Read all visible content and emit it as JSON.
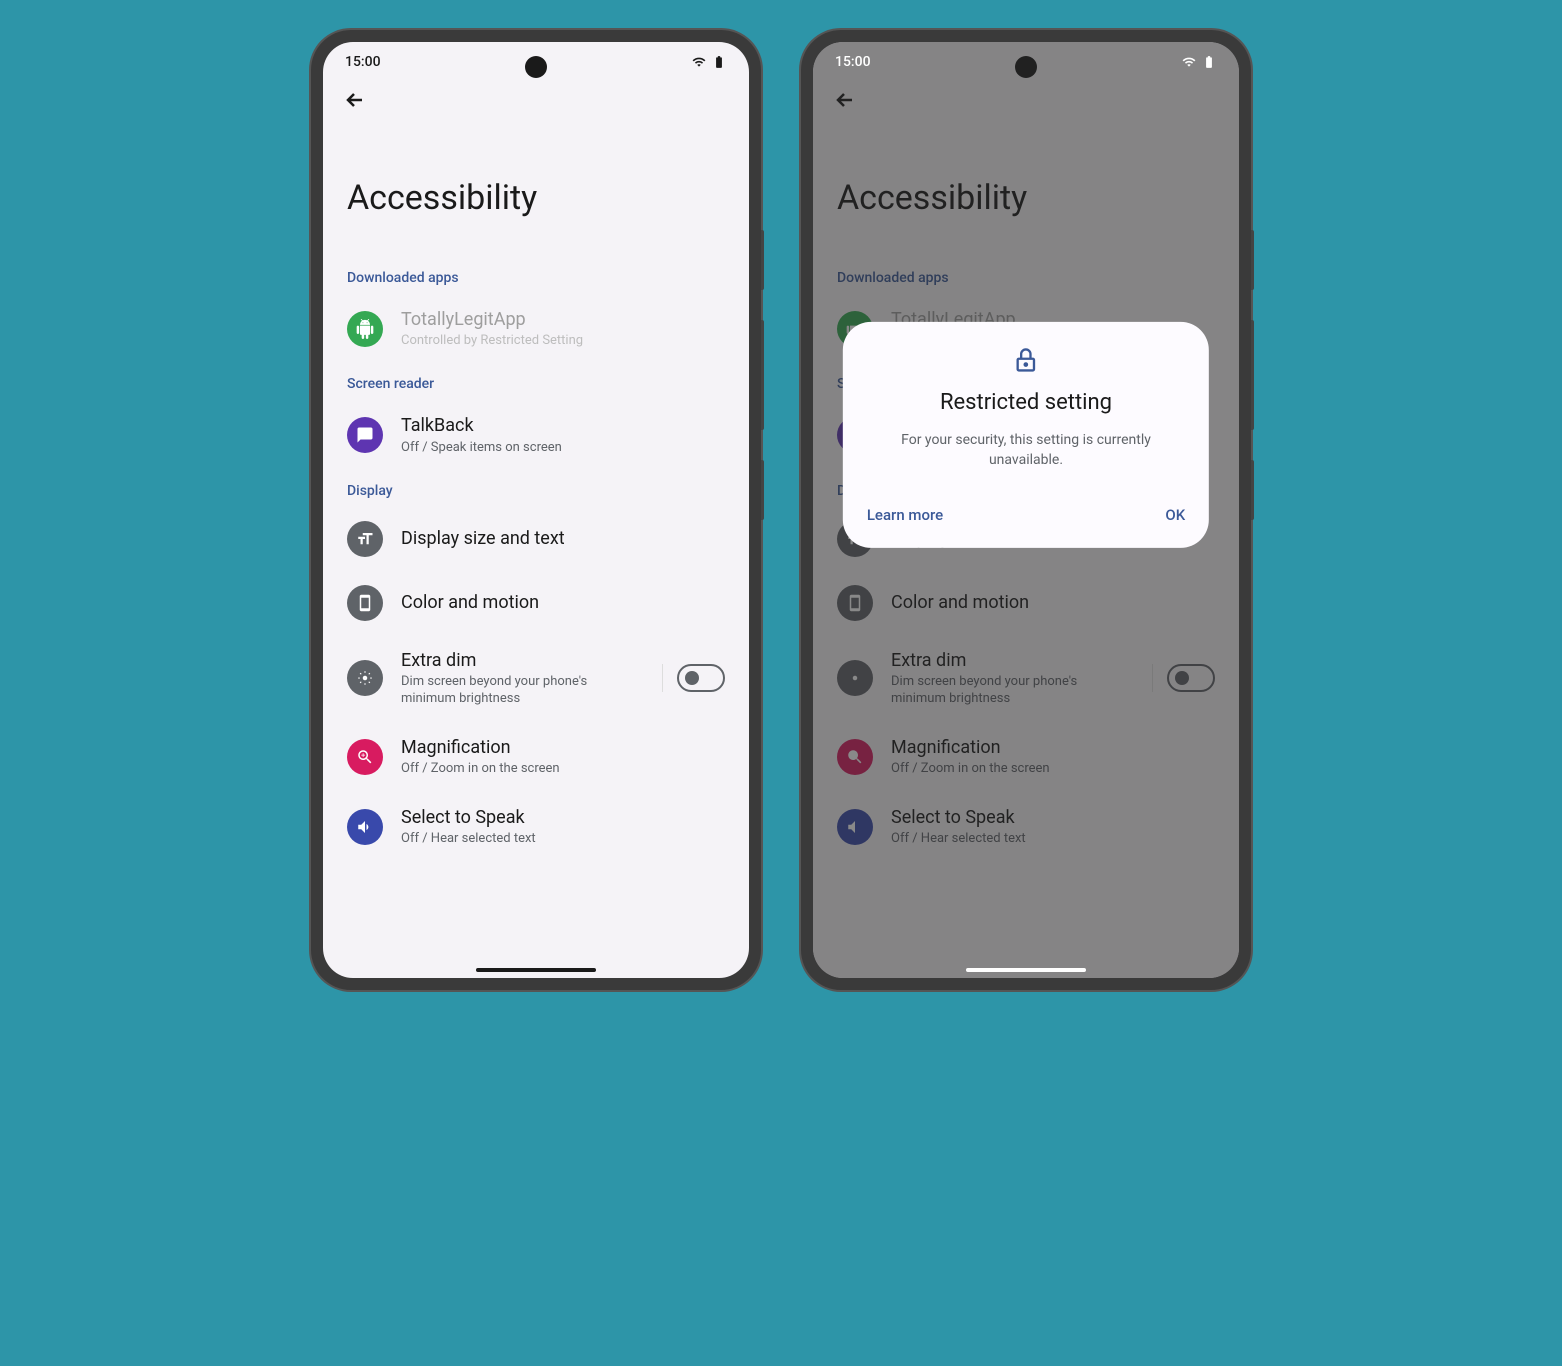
{
  "status": {
    "time": "15:00"
  },
  "header": {
    "title": "Accessibility"
  },
  "sections": {
    "downloaded": {
      "header": "Downloaded apps",
      "app": {
        "title": "TotallyLegitApp",
        "subtitle": "Controlled by Restricted Setting"
      }
    },
    "screen_reader": {
      "header": "Screen reader",
      "talkback": {
        "title": "TalkBack",
        "subtitle": "Off / Speak items on screen"
      }
    },
    "display": {
      "header": "Display",
      "display_size": {
        "title": "Display size and text"
      },
      "color_motion": {
        "title": "Color and motion"
      },
      "extra_dim": {
        "title": "Extra dim",
        "subtitle": "Dim screen beyond your phone's minimum brightness"
      },
      "magnification": {
        "title": "Magnification",
        "subtitle": "Off / Zoom in on the screen"
      },
      "select_speak": {
        "title": "Select to Speak",
        "subtitle": "Off / Hear selected text"
      }
    }
  },
  "dialog": {
    "title": "Restricted setting",
    "body": "For your security, this setting is currently unavailable.",
    "learn_more": "Learn more",
    "ok": "OK"
  }
}
